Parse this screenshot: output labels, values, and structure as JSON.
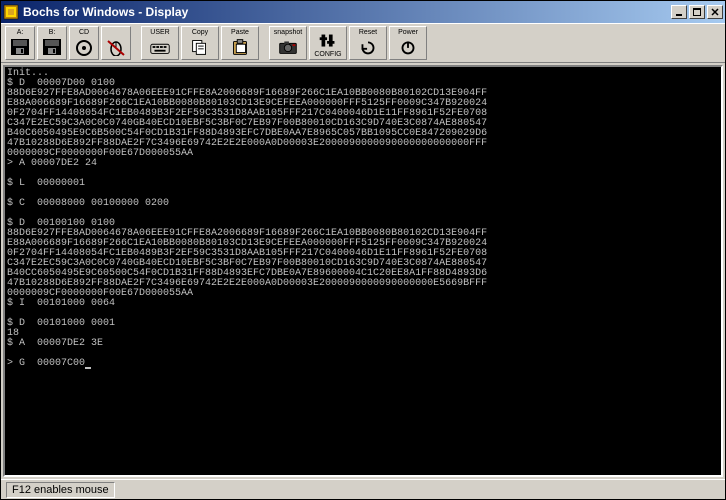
{
  "window": {
    "title": "Bochs for Windows - Display"
  },
  "toolbar": {
    "buttons": [
      {
        "id": "floppy-a",
        "top": "A:",
        "wide": false
      },
      {
        "id": "floppy-b",
        "top": "B:",
        "wide": false
      },
      {
        "id": "cdrom",
        "top": "CD",
        "wide": false
      },
      {
        "id": "mouse",
        "top": "",
        "wide": false
      },
      {
        "id": "sep",
        "sep": true
      },
      {
        "id": "user",
        "top": "USER",
        "wide": true
      },
      {
        "id": "copy",
        "top": "Copy",
        "wide": true
      },
      {
        "id": "paste",
        "top": "Paste",
        "wide": true
      },
      {
        "id": "sep2",
        "sep": true
      },
      {
        "id": "snapshot",
        "top": "snapshot",
        "wide": true
      },
      {
        "id": "config",
        "top": "",
        "bottom": "CONFIG",
        "wide": true
      },
      {
        "id": "reset",
        "top": "Reset",
        "wide": true
      },
      {
        "id": "power",
        "top": "Power",
        "wide": true
      }
    ]
  },
  "console": {
    "lines": [
      "Init...",
      "$ D  00007D00 0100",
      "88D6E927FFE8AD0064678A06EEE91CFFE8A2006689F16689F266C1EA10BB0080B80102CD13E904FF",
      "E88A006689F16689F266C1EA10BB0080B80103CD13E9CEFEEA000000FFF5125FF0009C347B920024",
      "0F2704FF14408054FC1EB0489B3F2EF59C3531D8AAB105FFF217C0400046D1E11FF8961F52FE0708",
      "C347E2EC59C3A0C0C0740GB40ECD10EBF5C3BF0C7EB97F00B80010CD163C9D740E3C0874AE880547",
      "B40C6050495E9C6B500C54F0CD1B31FF88D4893EFC7DBE0AA7E8965C057BB1095CC0E847209029D6",
      "47B10288D6E892FF88DAE2F7C3496E69742E2E2E000A0D00003E2000090000090000000000000FFF",
      "0000009CF0000000F00E67D000055AA",
      "> A 00007DE2 24",
      "",
      "$ L  00000001",
      "",
      "$ C  00008000 00100000 0200",
      "",
      "$ D  00100100 0100",
      "88D6E927FFE8AD0064678A06EEE91CFFE8A2006689F16689F266C1EA10BB0080B80102CD13E904FF",
      "E88A006689F16689F266C1EA10BB0080B80103CD13E9CEFEEA000000FFF5125FF0009C347B920024",
      "0F2704FF14408054FC1EB0489B3F2EF59C3531D8AAB105FFF217C0400046D1E11FF8961F52FE0708",
      "C347E2EC59C3A0C0C0740GB40ECD10EBF5C3BF0C7EB97F00B80010CD163C9D740E3C0874AE880547",
      "B40CC6050495E9C60500C54F0CD1B31FF88D4893EFC7DBE0A7E89600004C1C20EE8A1FF88D4893D6",
      "47B10288D6E892FF88DAE2F7C3496E69742E2E2E000A0D00003E2000090000090000000E5669BFFF",
      "0000009CF0000000F00E67D000055AA",
      "$ I  00101000 0064",
      "",
      "$ D  00101000 0001",
      "18",
      "$ A  00007DE2 3E",
      "",
      "> G  00007C00"
    ],
    "cursor_after_last": true
  },
  "statusbar": {
    "text": "F12 enables mouse"
  }
}
